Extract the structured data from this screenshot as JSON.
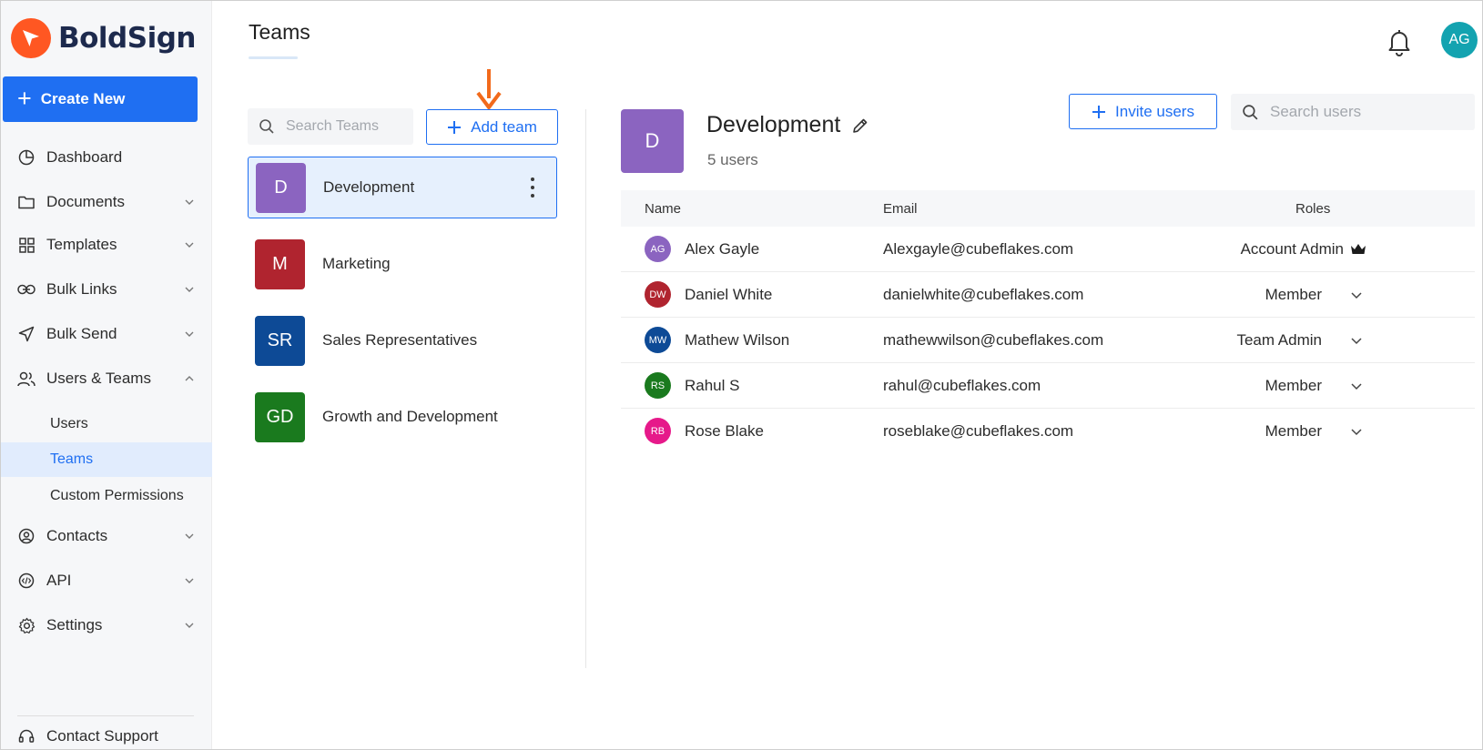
{
  "app": {
    "name": "BoldSign"
  },
  "sidebar": {
    "create_label": "Create New",
    "items": [
      {
        "label": "Dashboard"
      },
      {
        "label": "Documents"
      },
      {
        "label": "Templates"
      },
      {
        "label": "Bulk Links"
      },
      {
        "label": "Bulk Send"
      },
      {
        "label": "Users & Teams"
      },
      {
        "label": "Contacts"
      },
      {
        "label": "API"
      },
      {
        "label": "Settings"
      }
    ],
    "sub_items": [
      {
        "label": "Users"
      },
      {
        "label": "Teams"
      },
      {
        "label": "Custom Permissions"
      }
    ],
    "support_label": "Contact Support"
  },
  "header": {
    "title": "Teams",
    "user_initials": "AG"
  },
  "teams_pane": {
    "search_placeholder": "Search Teams",
    "add_label": "Add team",
    "teams": [
      {
        "initials": "D",
        "name": "Development",
        "color": "#8b64c0"
      },
      {
        "initials": "M",
        "name": "Marketing",
        "color": "#b0242f"
      },
      {
        "initials": "SR",
        "name": "Sales Representatives",
        "color": "#0d4a96"
      },
      {
        "initials": "GD",
        "name": "Growth and Development",
        "color": "#1a7a1e"
      }
    ]
  },
  "detail": {
    "initials": "D",
    "name": "Development",
    "user_count": "5 users",
    "invite_label": "Invite users",
    "search_placeholder": "Search users",
    "columns": {
      "name": "Name",
      "email": "Email",
      "roles": "Roles"
    },
    "users": [
      {
        "initials": "AG",
        "name": "Alex Gayle",
        "email": "Alexgayle@cubeflakes.com",
        "role": "Account Admin",
        "color": "#8b64c0"
      },
      {
        "initials": "DW",
        "name": "Daniel White",
        "email": "danielwhite@cubeflakes.com",
        "role": "Member",
        "color": "#b0242f"
      },
      {
        "initials": "MW",
        "name": "Mathew Wilson",
        "email": "mathewwilson@cubeflakes.com",
        "role": "Team Admin",
        "color": "#0d4a96"
      },
      {
        "initials": "RS",
        "name": "Rahul S",
        "email": "rahul@cubeflakes.com",
        "role": "Member",
        "color": "#1a7a1e"
      },
      {
        "initials": "RB",
        "name": "Rose Blake",
        "email": "roseblake@cubeflakes.com",
        "role": "Member",
        "color": "#e6198a"
      }
    ]
  },
  "colors": {
    "primary": "#1f6ff2",
    "brand": "#ff5722",
    "annotation_arrow": "#f26a1b"
  }
}
